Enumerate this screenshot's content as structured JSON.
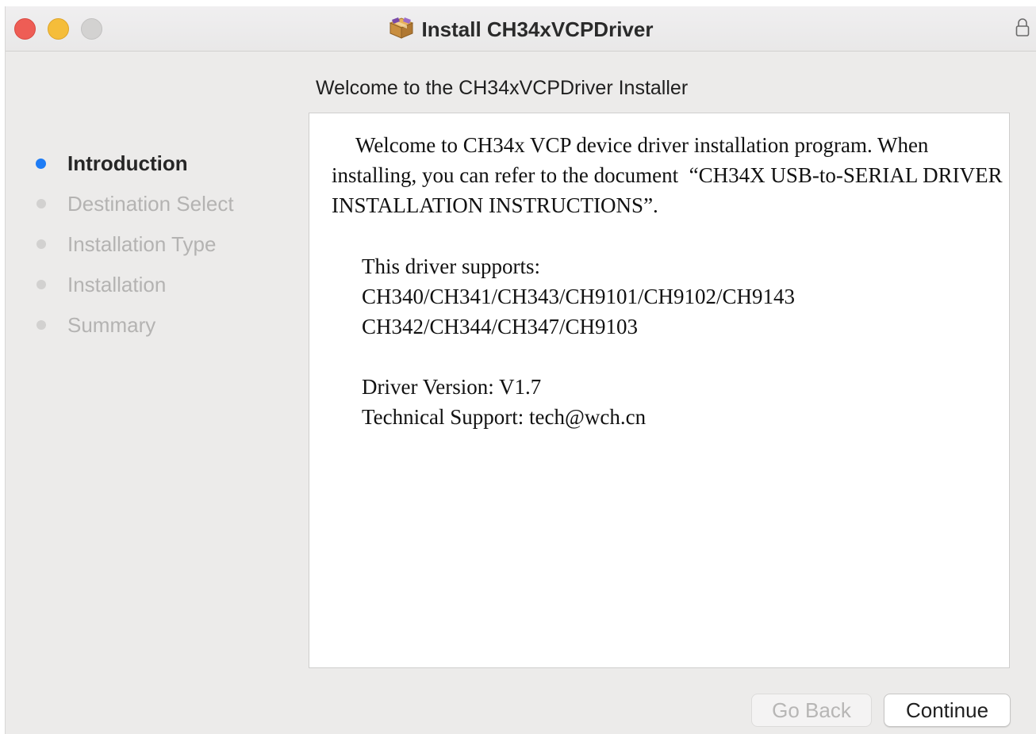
{
  "window": {
    "title": "Install CH34xVCPDriver",
    "title_icon": "package-icon",
    "lock_icon": "lock-icon",
    "traffic_lights": {
      "close_color": "#ee5d55",
      "minimize_color": "#f5bd3a",
      "zoom_color": "#d3d2d1"
    }
  },
  "page": {
    "heading": "Welcome to the CH34xVCPDriver Installer"
  },
  "sidebar": {
    "accent_color": "#1e7cf5",
    "steps": [
      {
        "label": "Introduction",
        "active": true
      },
      {
        "label": "Destination Select",
        "active": false
      },
      {
        "label": "Installation Type",
        "active": false
      },
      {
        "label": "Installation",
        "active": false
      },
      {
        "label": "Summary",
        "active": false
      }
    ]
  },
  "content": {
    "intro": "Welcome to CH34x VCP device driver installation program. When installing, you can refer to the document  “CH34X USB-to-SERIAL DRIVER INSTALLATION INSTRUCTIONS”.",
    "supports_label": "This driver supports:",
    "supports_line1": "CH340/CH341/CH343/CH9101/CH9102/CH9143",
    "supports_line2": "CH342/CH344/CH347/CH9103",
    "version": "Driver Version: V1.7",
    "support": "Technical Support: tech@wch.cn"
  },
  "buttons": {
    "back_label": "Go Back",
    "back_enabled": false,
    "continue_label": "Continue"
  }
}
